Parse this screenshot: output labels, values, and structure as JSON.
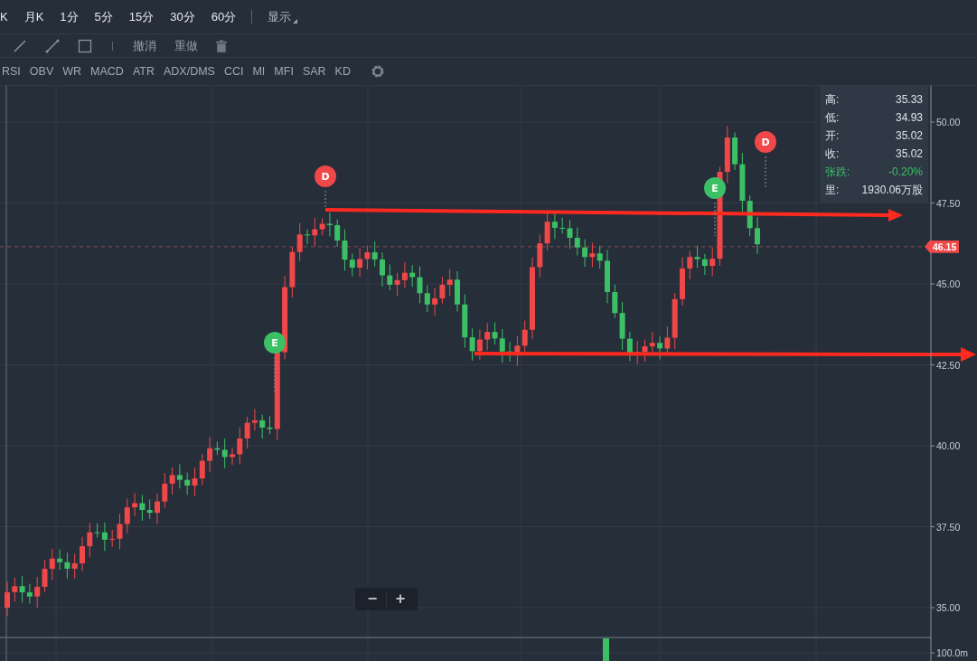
{
  "toolbar": {
    "periods": [
      {
        "label": "K"
      },
      {
        "label": "月K"
      },
      {
        "label": "1分"
      },
      {
        "label": "5分"
      },
      {
        "label": "15分"
      },
      {
        "label": "30分"
      },
      {
        "label": "60分"
      }
    ],
    "display_menu": {
      "label": "显示"
    }
  },
  "drawing_tools": {
    "actions": [
      "撤消",
      "重做"
    ]
  },
  "indicators": [
    "RSI",
    "OBV",
    "WR",
    "MACD",
    "ATR",
    "ADX/DMS",
    "CCI",
    "MI",
    "MFI",
    "SAR",
    "KD"
  ],
  "chart": {
    "price_ticks": [
      "50.00",
      "47.50",
      "45.00",
      "42.50",
      "40.00",
      "37.50",
      "35.00"
    ],
    "volume_ticks": [
      "100.0m"
    ],
    "last_price": "46.15",
    "markers": [
      {
        "label": "E",
        "color": "#3cc065"
      },
      {
        "label": "D",
        "color": "#f04848"
      },
      {
        "label": "E",
        "color": "#3cc065"
      },
      {
        "label": "D",
        "color": "#f04848"
      }
    ]
  },
  "info_panel": {
    "rows": [
      {
        "label": "高:",
        "value": "35.33",
        "kind": "plain"
      },
      {
        "label": "低:",
        "value": "34.93",
        "kind": "plain"
      },
      {
        "label": "开:",
        "value": "35.02",
        "kind": "plain"
      },
      {
        "label": "收:",
        "value": "35.02",
        "kind": "plain"
      },
      {
        "label": "张跌:",
        "value": "-0.20%",
        "kind": "change"
      },
      {
        "label": "里:",
        "value": "1930.06万股",
        "kind": "plain"
      }
    ]
  },
  "zoom": {
    "out": "−",
    "in": "+"
  }
}
